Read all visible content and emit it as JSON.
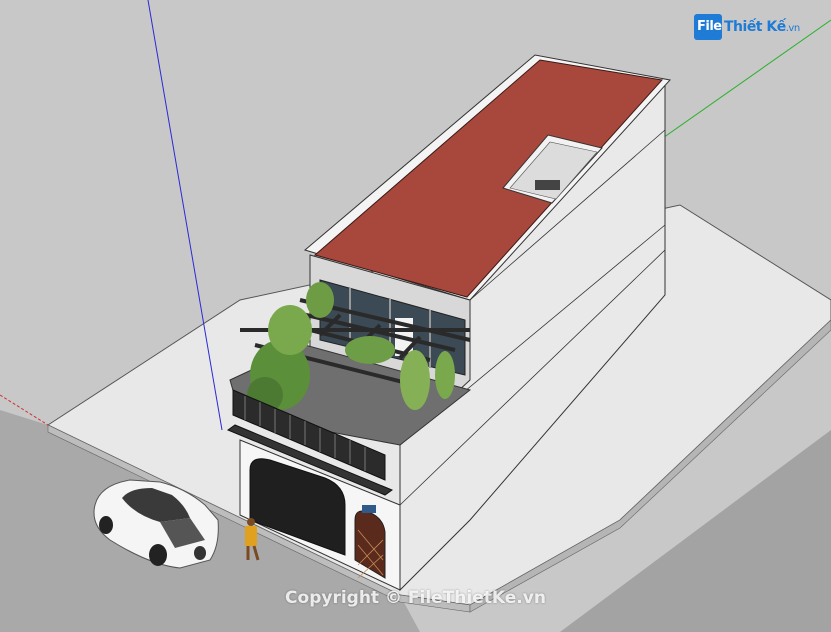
{
  "logo": {
    "prefix": "File",
    "name": "Thiết Kế",
    "suffix": ".vn"
  },
  "watermark": {
    "text": "Copyright © FileThietKe.vn"
  },
  "colors": {
    "background": "#c8c8c8",
    "ground": "#e6e6e6",
    "road": "#a8a8a8",
    "roof": "#a8473c",
    "walls": "#f2f2f2",
    "axis_blue": "#2a2ad6",
    "axis_green": "#2bb02b",
    "axis_red": "#d23030",
    "brand_blue": "#1e7bd6"
  }
}
